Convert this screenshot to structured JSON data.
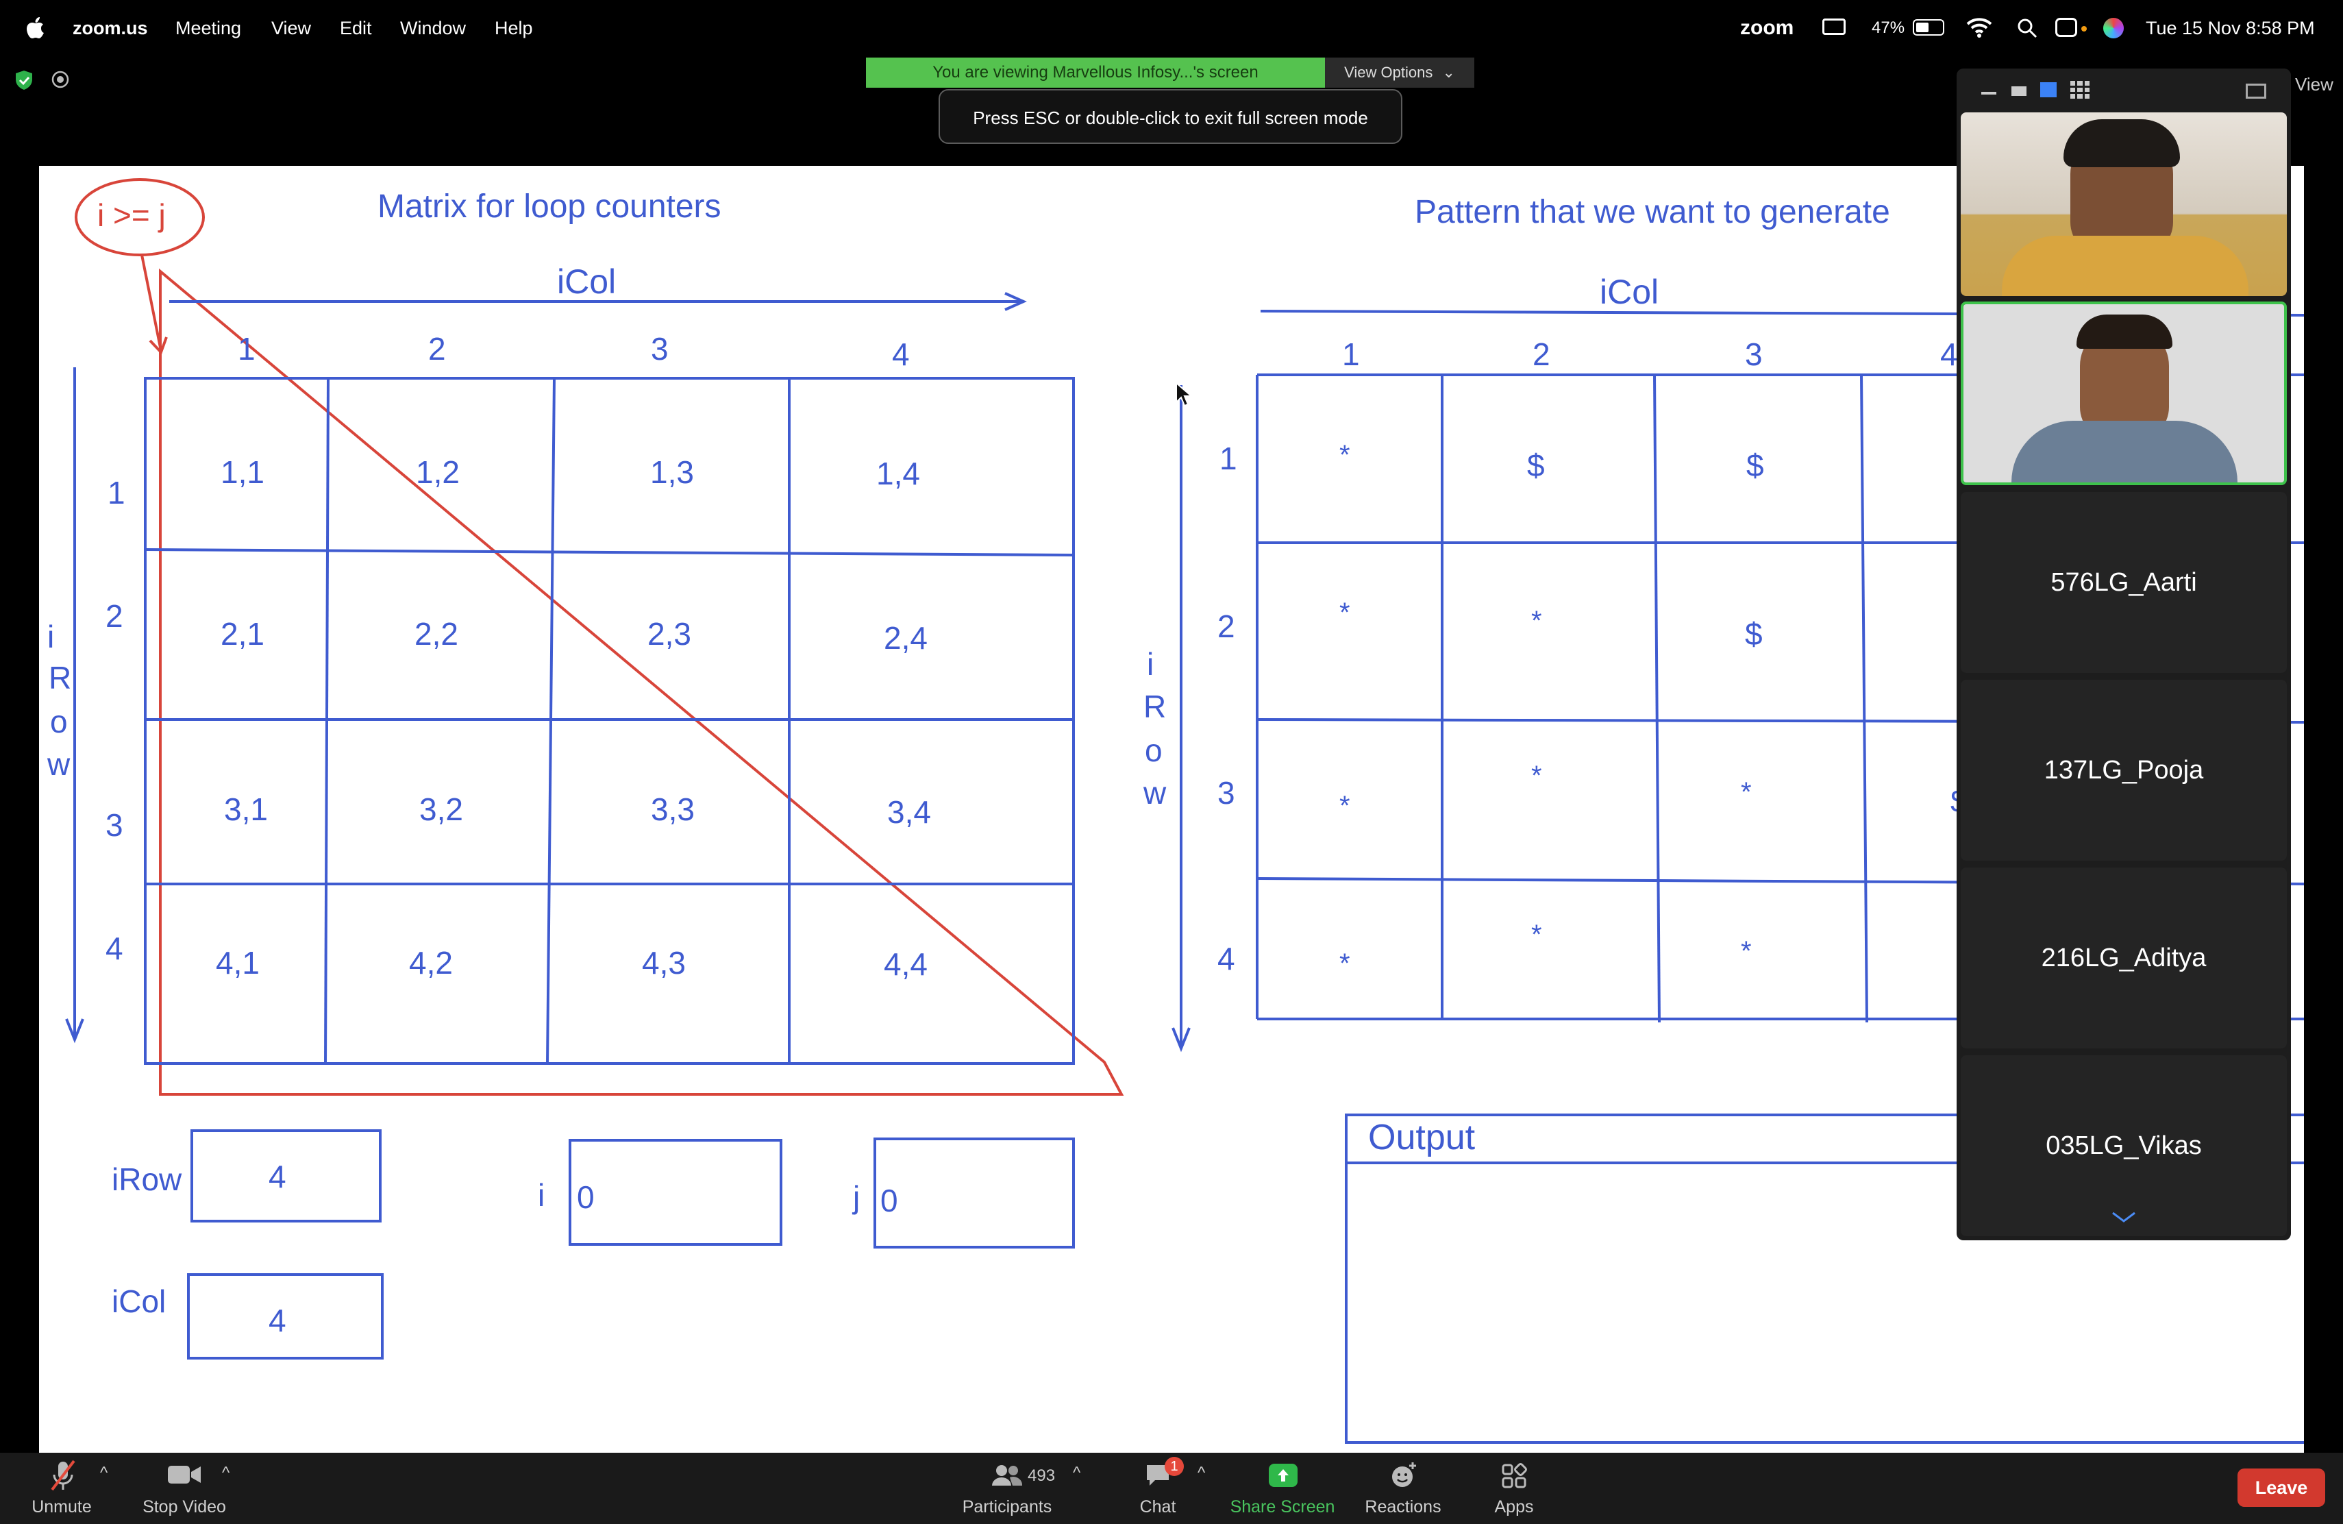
{
  "menubar": {
    "app_name": "zoom.us",
    "menus": [
      "Meeting",
      "View",
      "Edit",
      "Window",
      "Help"
    ],
    "zoom_logo": "zoom",
    "battery": "47%",
    "clock": "Tue 15 Nov  8:58 PM"
  },
  "share_banner": {
    "viewing_text": "You are viewing Marvellous Infosy...'s screen",
    "view_options_label": "View Options",
    "esc_toast": "Press ESC or double-click to exit full screen mode"
  },
  "whiteboard": {
    "condition": "i >= j",
    "matrix_title": "Matrix for loop counters",
    "pattern_title": "Pattern  that we want to generate",
    "col_axis_label": "iCol",
    "row_axis_letters": [
      "i",
      "R",
      "o",
      "w"
    ],
    "col_numbers": [
      "1",
      "2",
      "3",
      "4"
    ],
    "row_numbers": [
      "1",
      "2",
      "3",
      "4"
    ],
    "matrix_cells": [
      [
        "1,1",
        "1,2",
        "1,3",
        "1,4"
      ],
      [
        "2,1",
        "2,2",
        "2,3",
        "2,4"
      ],
      [
        "3,1",
        "3,2",
        "3,3",
        "3,4"
      ],
      [
        "4,1",
        "4,2",
        "4,3",
        "4,4"
      ]
    ],
    "pattern_col_numbers": [
      "1",
      "2",
      "3",
      "4"
    ],
    "pattern_row_numbers": [
      "1",
      "2",
      "3",
      "4"
    ],
    "pattern_cells": [
      [
        "*",
        "$",
        "$"
      ],
      [
        "*",
        "*",
        "$"
      ],
      [
        "*",
        "*",
        "*"
      ],
      [
        "*",
        "*",
        "*"
      ]
    ],
    "pattern_partial_cell": "$",
    "vars": {
      "irow_label": "iRow",
      "irow_value": "4",
      "icol_label": "iCol",
      "icol_value": "4",
      "i_label": "i",
      "i_value": "0",
      "j_label": "j",
      "j_value": "0"
    },
    "output_label": "Output"
  },
  "gallery": {
    "participants": [
      "576LG_Aarti",
      "137LG_Pooja",
      "216LG_Aditya",
      "035LG_Vikas"
    ],
    "view_label": "View"
  },
  "toolbar": {
    "unmute": "Unmute",
    "stop_video": "Stop Video",
    "participants": "Participants",
    "participant_count": "493",
    "chat": "Chat",
    "chat_badge": "1",
    "share_screen": "Share Screen",
    "reactions": "Reactions",
    "apps": "Apps",
    "leave": "Leave"
  },
  "colors": {
    "ink_blue": "#3f5bd0",
    "ink_red": "#d8453a",
    "share_green": "#55c24f",
    "leave_red": "#d2392e"
  }
}
